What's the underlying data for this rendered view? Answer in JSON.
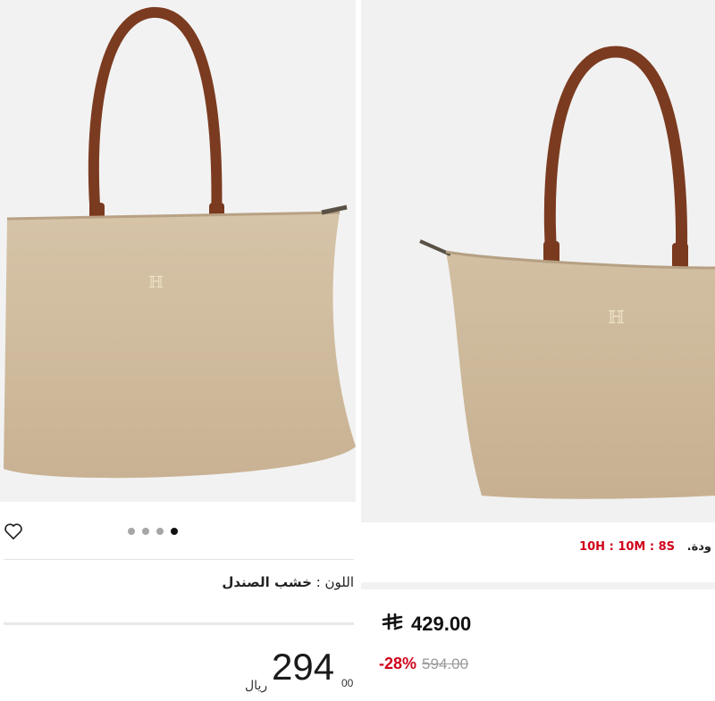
{
  "left": {
    "color_label": "اللون :",
    "color_value": "خشب الصندل",
    "price_integer": "294",
    "price_decimal": "00",
    "price_currency": "ريال",
    "carousel": {
      "count": 4,
      "active_index": 3
    },
    "icons": {
      "wishlist": "heart-icon"
    }
  },
  "right": {
    "timer_prefix": ".ودة",
    "timer_seconds": "8S",
    "timer_minutes": "10M",
    "timer_hours": "10H",
    "price": "429.00",
    "discount": "-28%",
    "old_price": "594.00",
    "icons": {
      "currency": "riyal-symbol-icon"
    }
  },
  "colors": {
    "accent_red": "#d0021b",
    "bag_body": "#cdb89b",
    "strap": "#7e3e22"
  }
}
